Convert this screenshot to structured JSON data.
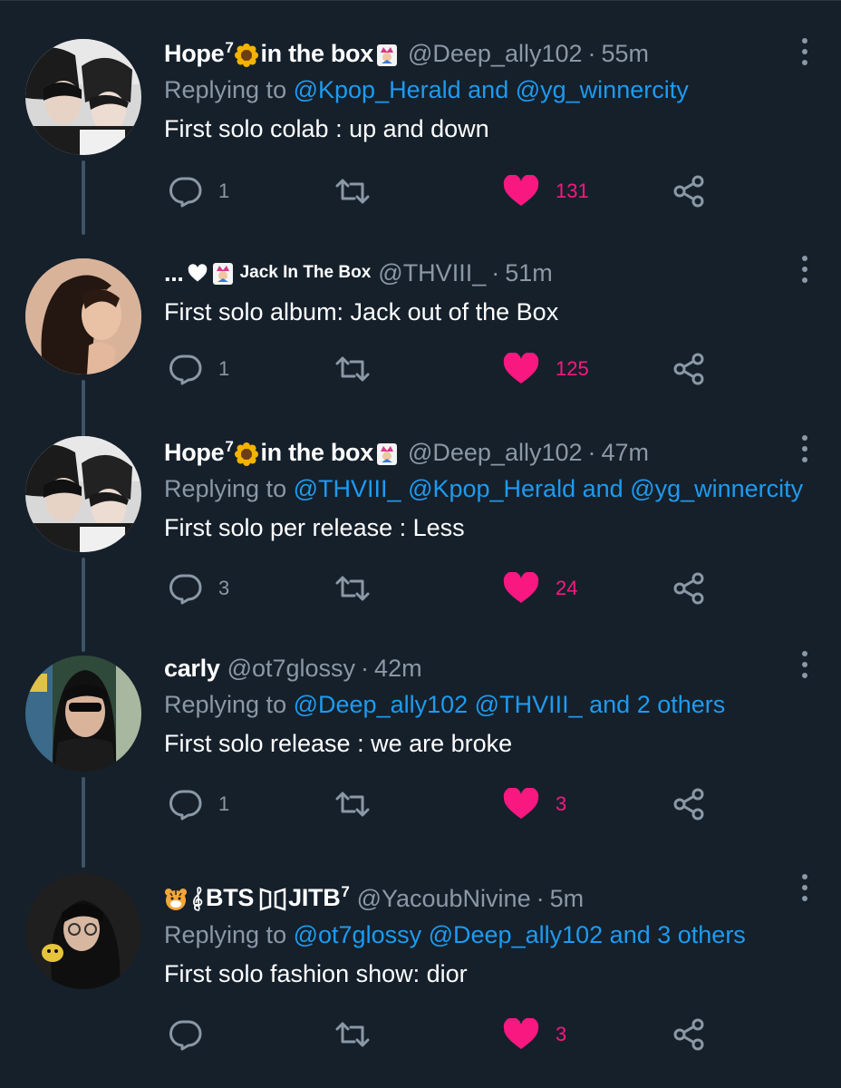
{
  "tweets": [
    {
      "name_part1": "Hope",
      "name_sup": "7",
      "name_part2": "in the box",
      "handle": "@Deep_ally102",
      "dot": "·",
      "time": "55m",
      "replying_prefix": "Replying to",
      "replying_mentions": [
        "@Kpop_Herald"
      ],
      "replying_and": "and",
      "replying_last": "@yg_winnercity",
      "text": "First solo colab : up and down",
      "replies": "1",
      "likes": "131"
    },
    {
      "name_part1": "...",
      "name_part2": "Jack In The Box",
      "handle": "@THVIII_",
      "dot": "·",
      "time": "51m",
      "text": "First solo album: Jack out of the Box",
      "replies": "1",
      "likes": "125"
    },
    {
      "name_part1": "Hope",
      "name_sup": "7",
      "name_part2": "in the box",
      "handle": "@Deep_ally102",
      "dot": "·",
      "time": "47m",
      "replying_prefix": "Replying to",
      "replying_mentions": [
        "@THVIII_",
        "@Kpop_Herald"
      ],
      "replying_and": "and",
      "replying_last": "@yg_winnercity",
      "text": "First solo per release : Less",
      "replies": "3",
      "likes": "24"
    },
    {
      "name_part1": "carly",
      "handle": "@ot7glossy",
      "dot": "·",
      "time": "42m",
      "replying_prefix": "Replying to",
      "replying_mentions": [
        "@Deep_ally102",
        "@THVIII_"
      ],
      "replying_and": "and",
      "replying_last": "2 others",
      "text": "First solo release : we are broke",
      "replies": "1",
      "likes": "3"
    },
    {
      "name_part1": "BTS",
      "name_part2": "JITB",
      "name_sup": "7",
      "handle": "@YacoubNivine",
      "dot": "·",
      "time": "5m",
      "replying_prefix": "Replying to",
      "replying_mentions": [
        "@ot7glossy",
        "@Deep_ally102"
      ],
      "replying_and": "and",
      "replying_last": "3 others",
      "text": "First solo fashion show: dior",
      "replies": "",
      "likes": "3"
    }
  ],
  "colors": {
    "background": "#15202b",
    "mention": "#1d9bf0",
    "secondary_text": "#8b98a5",
    "like": "#f91880",
    "thread_line": "#3d5466"
  }
}
